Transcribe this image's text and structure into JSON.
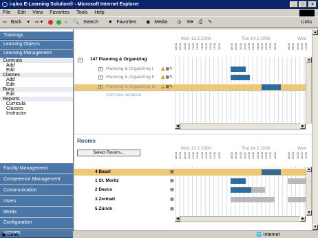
{
  "window": {
    "title": "i-qlox E-Learning Solution® - Microsoft Internet Explorer"
  },
  "menu": [
    "File",
    "Edit",
    "View",
    "Favorites",
    "Tools",
    "Help"
  ],
  "toolbar": {
    "back": "Back",
    "search": "Search",
    "favorites": "Favorites",
    "media": "Media",
    "links": "Links",
    "links_chevron": "»"
  },
  "sidebar": {
    "top_sections": [
      "Trainings",
      "Learning Objects",
      "Learning Management"
    ],
    "sub_items": [
      {
        "label": "Curricula",
        "group": true
      },
      {
        "label": "Add",
        "group": false
      },
      {
        "label": "Edit",
        "group": false
      },
      {
        "label": "Classes",
        "group": true
      },
      {
        "label": "Add",
        "group": false
      },
      {
        "label": "Edit",
        "group": false
      },
      {
        "label": "Runs",
        "group": true
      },
      {
        "label": "Edit",
        "group": false
      },
      {
        "label": "Reports",
        "group": true
      },
      {
        "label": "Curricula",
        "group": false
      },
      {
        "label": "Classes",
        "group": false
      },
      {
        "label": "Instructor",
        "group": false
      }
    ],
    "bottom_sections": [
      "Facility Management",
      "Competence Management",
      "Communication",
      "Users",
      "Media",
      "Configuration",
      "Reports"
    ]
  },
  "schedule": {
    "dates": [
      "Mon 13.2.2006",
      "Tue 14.2.2006",
      "Wed"
    ],
    "hours": [
      "08:00",
      "09:00",
      "10:00",
      "11:00",
      "12:00",
      "13:00",
      "14:00",
      "15:00",
      "16:00",
      "17:00",
      "18:00"
    ],
    "class_item": "147 Planning & Organizing",
    "toggle": "−",
    "instances": [
      "Planning & Organizing I",
      "Planning & Organizing II",
      "Planning & Organizing III"
    ],
    "add_instance": "Add new instance"
  },
  "rooms": {
    "title": "Rooms",
    "select_button": "Select Rooms...",
    "list": [
      "4 Basel",
      "1 St. Moritz",
      "2 Davos",
      "3 Zermatt",
      "5 Zürich"
    ]
  },
  "status": {
    "text": "Done",
    "zone": "Internet"
  },
  "colors": {
    "nav": "#4b76a8",
    "highlight": "#eec879",
    "bar": "#2f6b9a",
    "title_bar": "#0a246a"
  }
}
